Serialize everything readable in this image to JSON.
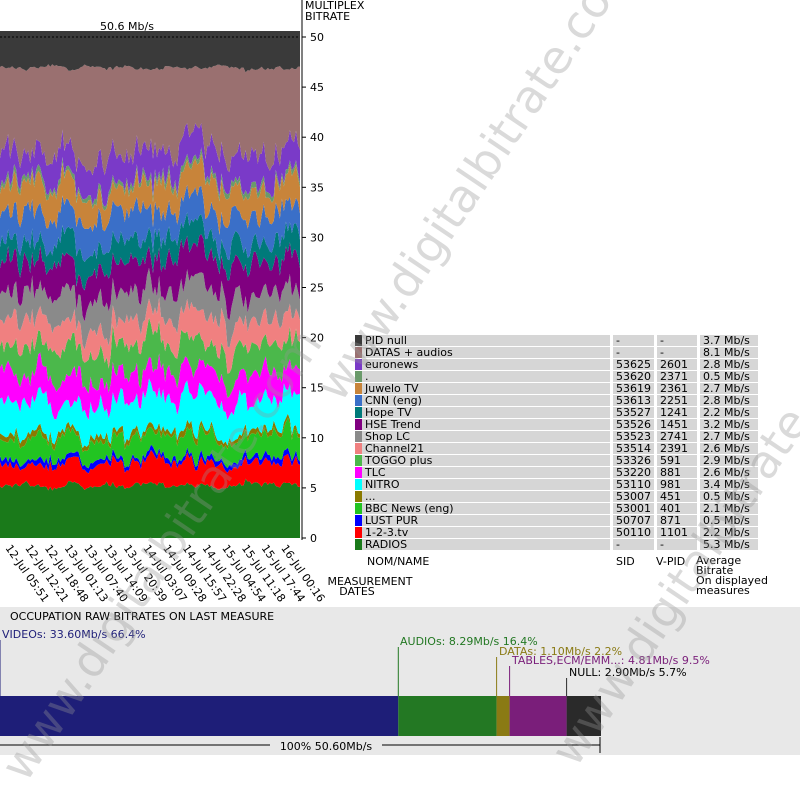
{
  "chart_data": [
    {
      "type": "area",
      "title": "50.6 Mb/s",
      "ylabel": "MULTIPLEX\nBITRATE",
      "xlabel": "MEASUREMENT\nDATES",
      "ylim": [
        0,
        50
      ],
      "yticks": [
        0,
        5,
        10,
        15,
        20,
        25,
        30,
        35,
        40,
        45,
        50
      ],
      "x_tick_labels": [
        "12-Jul 05:51",
        "12-Jul 12:21",
        "12-Jul 18:48",
        "13-Jul 01:13",
        "13-Jul 07:40",
        "13-Jul 14:09",
        "13-Jul 20:39",
        "14-Jul 03:07",
        "14-Jul 09:28",
        "14-Jul 15:57",
        "14-Jul 22:28",
        "15-Jul 04:54",
        "15-Jul 11:18",
        "15-Jul 17:44",
        "16-Jul 00:16"
      ],
      "series": [
        {
          "name": "RADIOS",
          "color": "#1a7a1a",
          "sid": "-",
          "vpid": "-",
          "bitrate": "5.3 Mb/s",
          "value": 5.3
        },
        {
          "name": "1-2-3.tv",
          "color": "#ff0000",
          "sid": "50110",
          "vpid": "1101",
          "bitrate": "2.2 Mb/s",
          "value": 2.2
        },
        {
          "name": "LUST PUR",
          "color": "#0000ff",
          "sid": "50707",
          "vpid": "871",
          "bitrate": "0.5 Mb/s",
          "value": 0.5
        },
        {
          "name": "BBC News (eng)",
          "color": "#22c422",
          "sid": "53001",
          "vpid": "401",
          "bitrate": "2.1 Mb/s",
          "value": 2.1
        },
        {
          "name": "...",
          "color": "#8a7a00",
          "sid": "53007",
          "vpid": "451",
          "bitrate": "0.5 Mb/s",
          "value": 0.5
        },
        {
          "name": "NITRO",
          "color": "#00ffff",
          "sid": "53110",
          "vpid": "981",
          "bitrate": "3.4 Mb/s",
          "value": 3.4
        },
        {
          "name": "TLC",
          "color": "#ff00ff",
          "sid": "53220",
          "vpid": "881",
          "bitrate": "2.6 Mb/s",
          "value": 2.6
        },
        {
          "name": "TOGGO plus",
          "color": "#4bb84b",
          "sid": "53326",
          "vpid": "591",
          "bitrate": "2.9 Mb/s",
          "value": 2.9
        },
        {
          "name": "Channel21",
          "color": "#f08080",
          "sid": "53514",
          "vpid": "2391",
          "bitrate": "2.6 Mb/s",
          "value": 2.6
        },
        {
          "name": "Shop LC",
          "color": "#8a8a8a",
          "sid": "53523",
          "vpid": "2741",
          "bitrate": "2.7 Mb/s",
          "value": 2.7
        },
        {
          "name": "HSE Trend",
          "color": "#800080",
          "sid": "53526",
          "vpid": "1451",
          "bitrate": "3.2 Mb/s",
          "value": 3.2
        },
        {
          "name": "Hope TV",
          "color": "#007a7a",
          "sid": "53527",
          "vpid": "1241",
          "bitrate": "2.2 Mb/s",
          "value": 2.2
        },
        {
          "name": "CNN (eng)",
          "color": "#3a6fc8",
          "sid": "53613",
          "vpid": "2251",
          "bitrate": "2.8 Mb/s",
          "value": 2.8
        },
        {
          "name": "Juwelo TV",
          "color": "#c8843a",
          "sid": "53619",
          "vpid": "2361",
          "bitrate": "2.7 Mb/s",
          "value": 2.7
        },
        {
          "name": ".",
          "color": "#6a9a6a",
          "sid": "53620",
          "vpid": "2371",
          "bitrate": "0.5 Mb/s",
          "value": 0.5
        },
        {
          "name": "euronews",
          "color": "#7a3ac8",
          "sid": "53625",
          "vpid": "2601",
          "bitrate": "2.8 Mb/s",
          "value": 2.8
        },
        {
          "name": "DATAS + audios",
          "color": "#9a7070",
          "sid": "-",
          "vpid": "-",
          "bitrate": "8.1 Mb/s",
          "value": 8.1
        },
        {
          "name": "PID null",
          "color": "#3a3a3a",
          "sid": "-",
          "vpid": "-",
          "bitrate": "3.7 Mb/s",
          "value": 3.7
        }
      ]
    },
    {
      "type": "bar",
      "title": "OCCUPATION RAW BITRATES ON LAST MEASURE",
      "total_label": "100%  50.60Mb/s",
      "segments": [
        {
          "label": "VIDEOs: 33.60Mb/s  66.4%",
          "value": 33.6,
          "percent": 66.4,
          "color": "#1e1e78",
          "text_color": "#1e1e78"
        },
        {
          "label": "AUDIOs: 8.29Mb/s  16.4%",
          "value": 8.29,
          "percent": 16.4,
          "color": "#237823",
          "text_color": "#237823"
        },
        {
          "label": "DATAs: 1.10Mb/s  2.2%",
          "value": 1.1,
          "percent": 2.2,
          "color": "#8a7a14",
          "text_color": "#8a7a14"
        },
        {
          "label": "TABLES,ECM/EMM...: 4.81Mb/s  9.5%",
          "value": 4.81,
          "percent": 9.5,
          "color": "#7a1e7a",
          "text_color": "#7a1e7a"
        },
        {
          "label": "NULL: 2.90Mb/s  5.7%",
          "value": 2.9,
          "percent": 5.7,
          "color": "#2a2a2a",
          "text_color": "#000000"
        }
      ]
    }
  ],
  "legend_headers": {
    "name": "NOM/NAME",
    "sid": "SID",
    "vpid": "V-PID",
    "bitrate": "Average\nBitrate\nOn displayed\nmeasures"
  },
  "watermark": "www.digitalbitrate.com"
}
